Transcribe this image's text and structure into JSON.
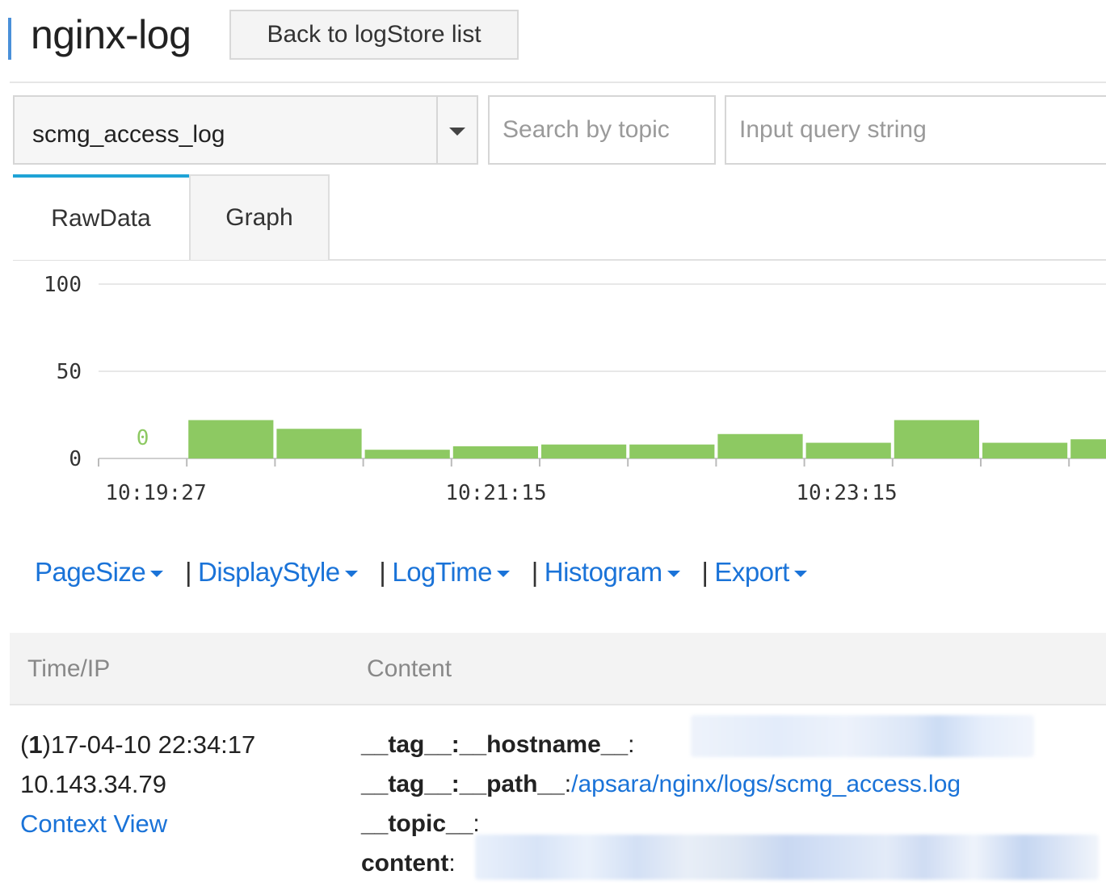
{
  "header": {
    "title": "nginx-log",
    "back_label": "Back to logStore list"
  },
  "filters": {
    "logstore_selected": "scmg_access_log",
    "topic_placeholder": "Search by topic",
    "query_placeholder": "Input query string"
  },
  "tabs": [
    {
      "label": "RawData",
      "active": true
    },
    {
      "label": "Graph",
      "active": false
    }
  ],
  "chart_data": {
    "type": "bar",
    "y_ticks": [
      "100",
      "50",
      "0"
    ],
    "ylim": [
      0,
      100
    ],
    "x_tick_labels": [
      "10:19:27",
      "10:21:15",
      "10:23:15"
    ],
    "values": [
      0,
      22,
      17,
      5,
      7,
      8,
      8,
      14,
      9,
      22,
      9,
      11
    ],
    "data_labels": [
      "0"
    ],
    "bar_color": "#8dc962",
    "zero_label_color": "#8dc962"
  },
  "toolbar": {
    "items": [
      "PageSize",
      "DisplayStyle",
      "LogTime",
      "Histogram",
      "Export"
    ],
    "separator": "|"
  },
  "table": {
    "headers": [
      "Time/IP",
      "Content"
    ],
    "rows": [
      {
        "index": "1",
        "time": "17-04-10 22:34:17",
        "ip": "10.143.34.79",
        "context_link": "Context View",
        "fields": [
          {
            "key": "__tag__:__hostname__",
            "value": ""
          },
          {
            "key": "__tag__:__path__",
            "value": "/apsara/nginx/logs/scmg_access.log"
          },
          {
            "key": "__topic__",
            "value": ""
          },
          {
            "key": "content",
            "value": ""
          }
        ]
      }
    ]
  },
  "colors": {
    "accent": "#1fa3d6",
    "link": "#1a73d8"
  }
}
